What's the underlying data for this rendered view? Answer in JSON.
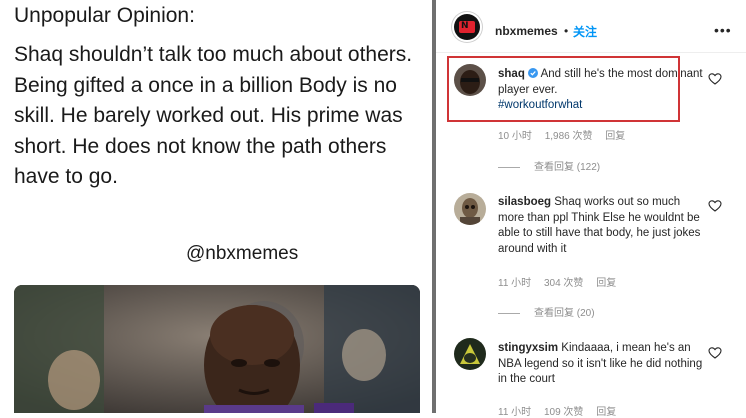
{
  "post": {
    "heading": "Unpopular Opinion:",
    "body": "Shaq shouldn’t talk too much about others. Being gifted a once in a billion Body is no skill. He barely worked out. His prime was short. He does not know the path others have to go.",
    "watermark": "@nbxmemes"
  },
  "header": {
    "username": "nbxmemes",
    "dot": "•",
    "follow": "关注",
    "more": "•••"
  },
  "comments": [
    {
      "user": "shaq",
      "verified": true,
      "text": "And still he's the most dominant player ever.",
      "hashtag": "#workoutforwhat",
      "time": "10 小时",
      "likes": "1,986 次赞",
      "reply": "回复",
      "view_replies": "查看回复 (122)"
    },
    {
      "user": "silasboeg",
      "text": "Shaq works out so much more than ppl Think Else he wouldnt be able to still have that body, he just jokes around with it",
      "time": "11 小时",
      "likes": "304 次赞",
      "reply": "回复",
      "view_replies": "查看回复 (20)"
    },
    {
      "user": "stingyxsim",
      "text": "Kindaaaa, i mean he's an NBA legend so it isn't like he did nothing in the court",
      "time": "11 小时",
      "likes": "109 次赞",
      "reply": "回复"
    }
  ],
  "colors": {
    "highlight": "#d03436",
    "follow": "#0095f6",
    "hashtag": "#00376b",
    "verified": "#3897f0"
  }
}
